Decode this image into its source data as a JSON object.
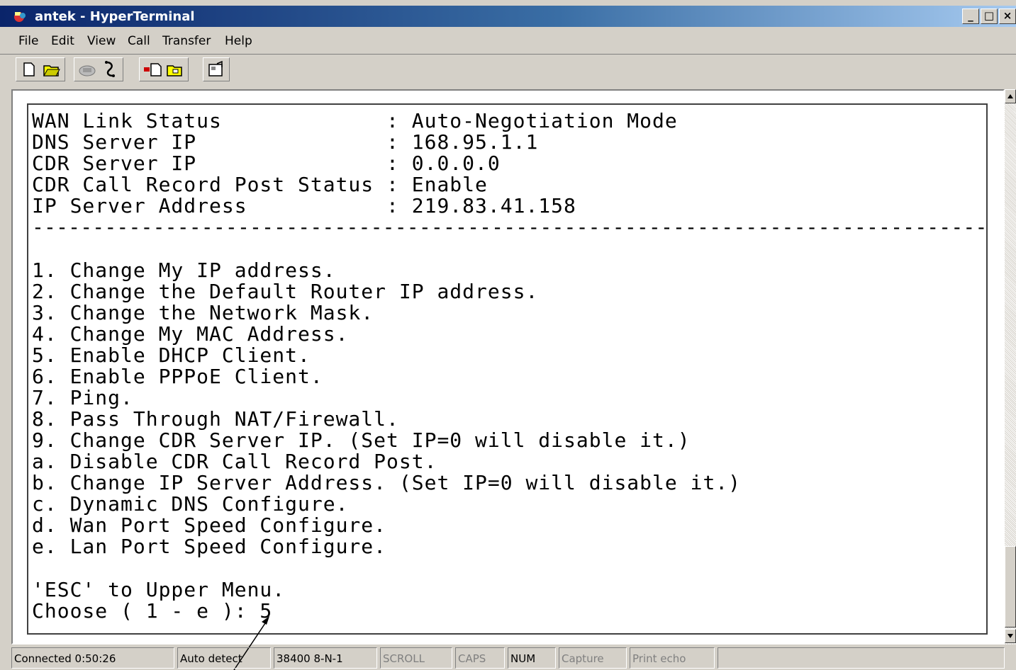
{
  "window": {
    "title": "antek - HyperTerminal",
    "controls": {
      "minimize": "_",
      "maximize": "□",
      "close": "×"
    }
  },
  "menu": [
    "File",
    "Edit",
    "View",
    "Call",
    "Transfer",
    "Help"
  ],
  "toolbar": {
    "icons": [
      "new-icon",
      "open-icon",
      "call-icon",
      "disconnect-icon",
      "send-icon",
      "receive-icon",
      "properties-icon"
    ]
  },
  "terminal": {
    "lines": [
      "WAN Link Status             : Auto-Negotiation Mode",
      "DNS Server IP               : 168.95.1.1",
      "CDR Server IP               : 0.0.0.0",
      "CDR Call Record Post Status : Enable",
      "IP Server Address           : 219.83.41.158",
      "-------------------------------------------------------------------------------",
      "",
      "1. Change My IP address.",
      "2. Change the Default Router IP address.",
      "3. Change the Network Mask.",
      "4. Change My MAC Address.",
      "5. Enable DHCP Client.",
      "6. Enable PPPoE Client.",
      "7. Ping.",
      "8. Pass Through NAT/Firewall.",
      "9. Change CDR Server IP. (Set IP=0 will disable it.)",
      "a. Disable CDR Call Record Post.",
      "b. Change IP Server Address. (Set IP=0 will disable it.)",
      "c. Dynamic DNS Configure.",
      "d. Wan Port Speed Configure.",
      "e. Lan Port Speed Configure.",
      "",
      "'ESC' to Upper Menu.",
      "Choose ( 1 - e ): 5"
    ]
  },
  "statusbar": {
    "connected": "Connected 0:50:26",
    "detect": "Auto detect",
    "settings": "38400 8-N-1",
    "scroll": "SCROLL",
    "caps": "CAPS",
    "num": "NUM",
    "capture": "Capture",
    "print_echo": "Print echo"
  }
}
